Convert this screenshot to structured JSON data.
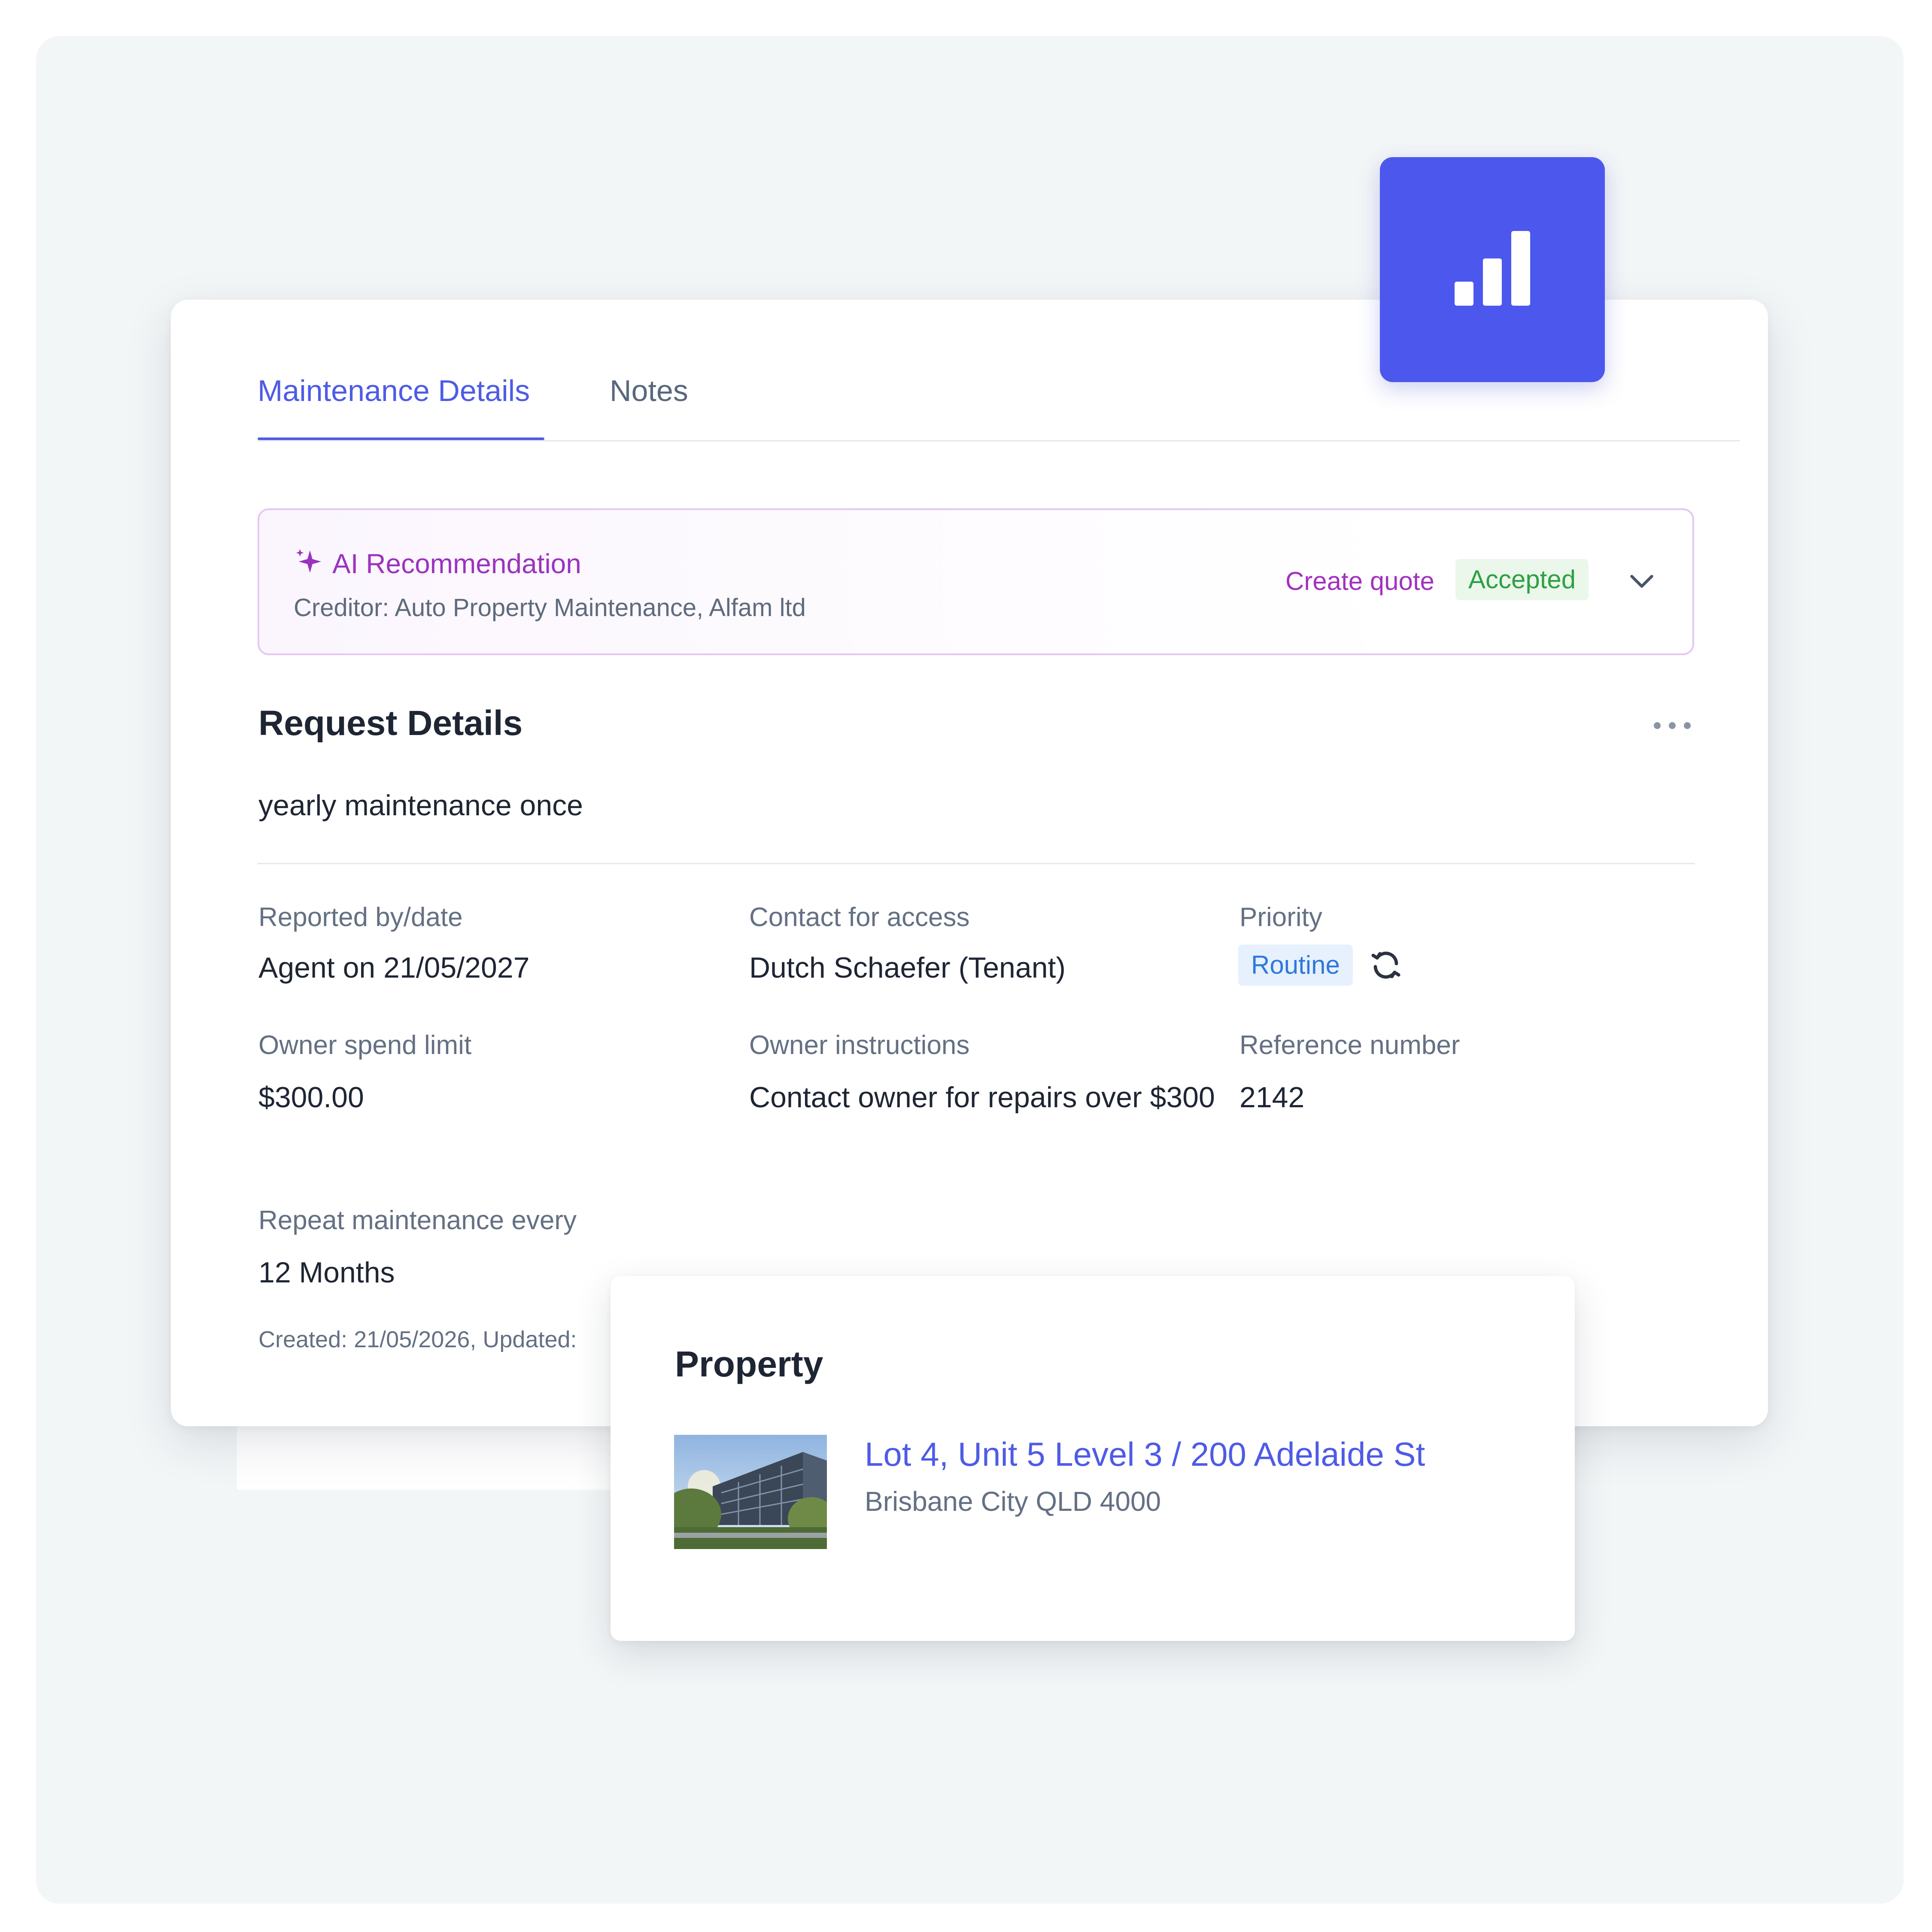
{
  "tabs": [
    {
      "label": "Maintenance Details",
      "active": true
    },
    {
      "label": "Notes",
      "active": false
    }
  ],
  "chart_badge": {
    "icon": "bar-chart-icon",
    "color": "#4c57ee"
  },
  "ai_recommendation": {
    "title": "AI Recommendation",
    "icon": "sparkle-icon",
    "creditor": "Creditor: Auto Property Maintenance, Alfam ltd",
    "action_label": "Create quote",
    "status": "Accepted",
    "expand_icon": "chevron-down-icon"
  },
  "request": {
    "title": "Request Details",
    "more_icon": "more-horizontal-icon",
    "description": "yearly maintenance once"
  },
  "fields": {
    "reported": {
      "label": "Reported by/date",
      "value": "Agent on 21/05/2027"
    },
    "contact": {
      "label": "Contact for access",
      "value": "Dutch Schaefer (Tenant)"
    },
    "priority": {
      "label": "Priority",
      "value": "Routine",
      "icon": "refresh-icon"
    },
    "spend_limit": {
      "label": "Owner spend limit",
      "value": "$300.00"
    },
    "instructions": {
      "label": "Owner instructions",
      "value": "Contact owner for repairs over $300"
    },
    "reference": {
      "label": "Reference number",
      "value": "2142"
    },
    "repeat": {
      "label": "Repeat maintenance every",
      "value": "12 Months"
    }
  },
  "meta": {
    "text": "Created: 21/05/2026, Updated: "
  },
  "property": {
    "title": "Property",
    "address": "Lot 4, Unit 5 Level 3 / 200 Adelaide St",
    "city": "Brisbane City QLD 4000",
    "photo": "building-photo"
  },
  "colors": {
    "accent": "#4e5be6",
    "ai_purple": "#9b33bf",
    "accepted_green": "#2fa043",
    "routine_blue": "#2f78de",
    "background": "#f3f6f7"
  }
}
